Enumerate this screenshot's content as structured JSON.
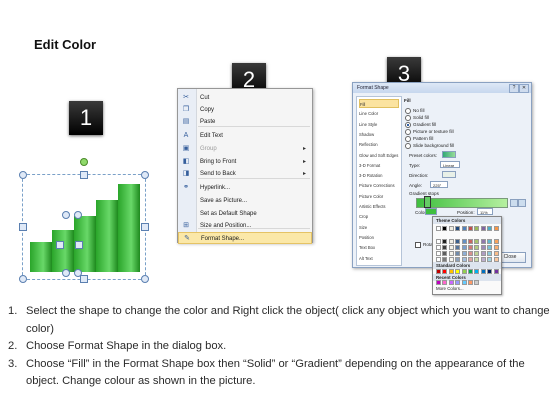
{
  "title": "Edit Color",
  "steps": [
    "1",
    "2",
    "3"
  ],
  "context_menu": {
    "items": [
      {
        "icon": "scissors-icon",
        "glyph": "✂",
        "label": "Cut",
        "disabled": false,
        "submenu": false
      },
      {
        "icon": "copy-icon",
        "glyph": "❐",
        "label": "Copy",
        "disabled": false,
        "submenu": false
      },
      {
        "icon": "paste-icon",
        "glyph": "▤",
        "label": "Paste",
        "disabled": false,
        "submenu": false
      },
      {
        "icon": "edit-text-icon",
        "glyph": "A",
        "label": "Edit Text",
        "disabled": false,
        "submenu": false
      },
      {
        "icon": "group-icon",
        "glyph": "▣",
        "label": "Group",
        "disabled": true,
        "submenu": true
      },
      {
        "icon": "bring-front-icon",
        "glyph": "◧",
        "label": "Bring to Front",
        "disabled": false,
        "submenu": true
      },
      {
        "icon": "send-back-icon",
        "glyph": "◨",
        "label": "Send to Back",
        "disabled": false,
        "submenu": true
      },
      {
        "icon": "hyperlink-icon",
        "glyph": "⚭",
        "label": "Hyperlink...",
        "disabled": false,
        "submenu": false
      },
      {
        "icon": "save-picture-icon",
        "glyph": "",
        "label": "Save as Picture...",
        "disabled": false,
        "submenu": false
      },
      {
        "icon": "default-shape-icon",
        "glyph": "",
        "label": "Set as Default Shape",
        "disabled": false,
        "submenu": false
      },
      {
        "icon": "size-position-icon",
        "glyph": "⊞",
        "label": "Size and Position...",
        "disabled": false,
        "submenu": false
      },
      {
        "icon": "format-shape-icon",
        "glyph": "✎",
        "label": "Format Shape...",
        "disabled": false,
        "submenu": false,
        "highlighted": true
      }
    ]
  },
  "format_dialog": {
    "title": "Format Shape",
    "categories": [
      "Fill",
      "Line Color",
      "Line Style",
      "Shadow",
      "Reflection",
      "Glow and Soft Edges",
      "3-D Format",
      "3-D Rotation",
      "Picture Corrections",
      "Picture Color",
      "Artistic Effects",
      "Crop",
      "Size",
      "Position",
      "Text Box",
      "Alt Text"
    ],
    "section": "Fill",
    "fill_options": [
      "No fill",
      "Solid fill",
      "Gradient fill",
      "Picture or texture fill",
      "Pattern fill",
      "Slide background fill"
    ],
    "selected_fill": "Gradient fill",
    "labels": {
      "preset": "Preset colors:",
      "type": "Type:",
      "type_value": "Linear",
      "direction": "Direction:",
      "angle": "Angle:",
      "angle_value": "225°",
      "gradient_stops": "Gradient stops",
      "color": "Color",
      "position": "Position:",
      "position_value": "11%",
      "brightness": "Brightness:",
      "transparency": "Transparency:",
      "rotate": "Rotate with shape"
    },
    "close_label": "Close",
    "palette": {
      "theme_label": "Theme Colors",
      "standard_label": "Standard Colors",
      "recent_label": "Recent Colors",
      "more_label": "More Colors...",
      "theme_colors": [
        "#ffffff",
        "#000000",
        "#eeece1",
        "#1f497d",
        "#4f81bd",
        "#c0504d",
        "#9bbb59",
        "#8064a2",
        "#4bacc6",
        "#f79646"
      ],
      "standard_colors": [
        "#c00000",
        "#ff0000",
        "#ffc000",
        "#ffff00",
        "#92d050",
        "#00b050",
        "#00b0f0",
        "#0070c0",
        "#002060",
        "#7030a0"
      ],
      "recent_colors": [
        "#c000c0",
        "#ff66cc",
        "#cc66ff",
        "#9999ff",
        "#66ccff",
        "#ff9966",
        "#cccccc"
      ]
    }
  },
  "instructions": [
    {
      "num": "1.",
      "text": "Select the shape to change the color and Right click the object( click any object which you want to change color)"
    },
    {
      "num": "2.",
      "text": "Choose Format Shape in the dialog box."
    },
    {
      "num": "3.",
      "text": "Choose “Fill” in the Format Shape box then “Solid” or “Gradient” depending on the appearance of the object. Change colour as shown in the picture."
    }
  ]
}
